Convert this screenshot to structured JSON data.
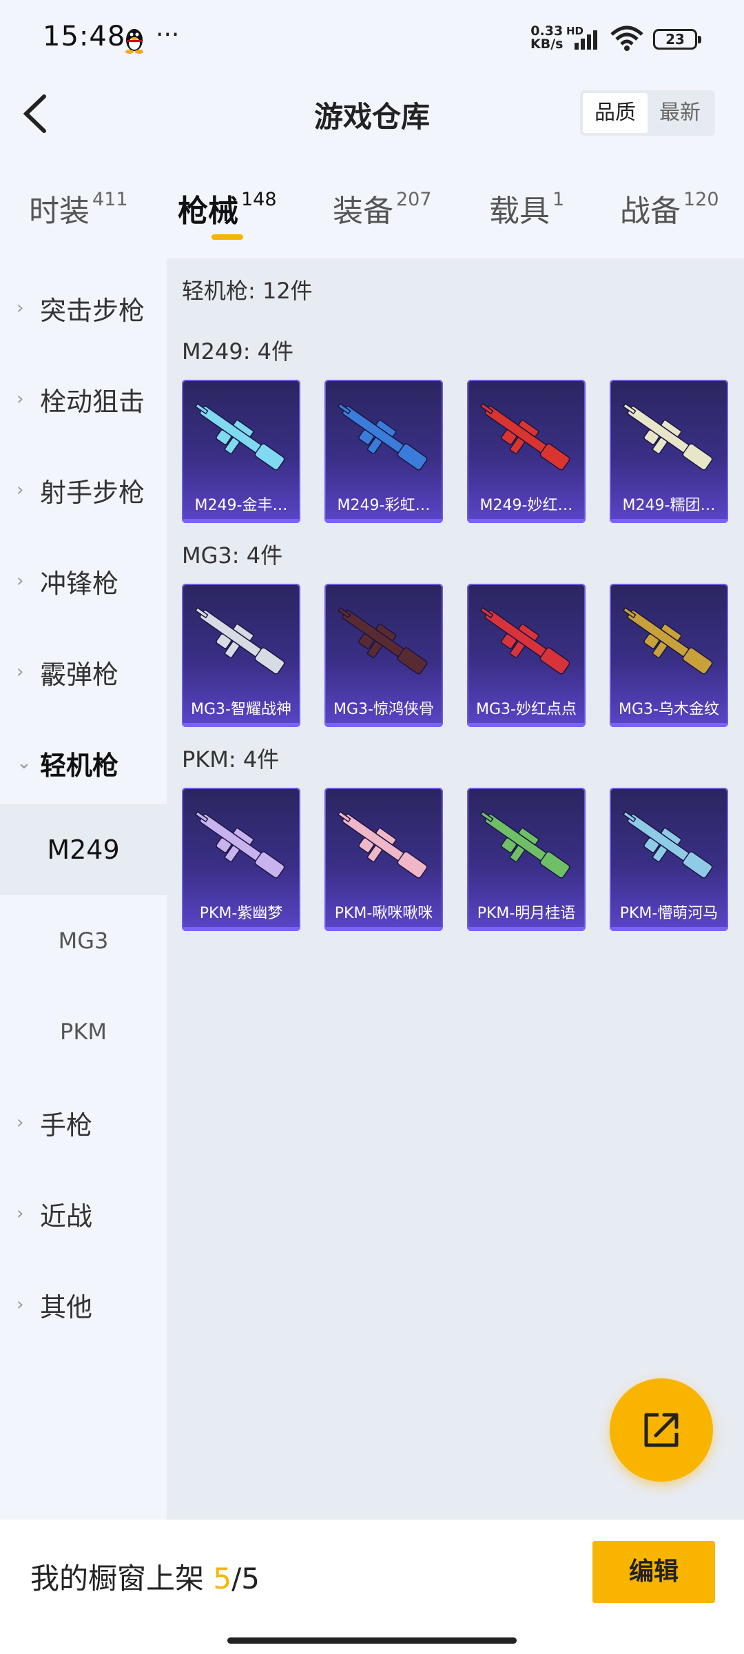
{
  "status": {
    "time": "15:48",
    "dots": "···",
    "net_speed_value": "0.33",
    "net_speed_unit": "KB/s",
    "hd": "HD",
    "battery": "23"
  },
  "header": {
    "title": "游戏仓库",
    "sort_options": [
      "品质",
      "最新"
    ],
    "sort_active": "品质"
  },
  "tabs": [
    {
      "label": "时装",
      "count": "411"
    },
    {
      "label": "枪械",
      "count": "148"
    },
    {
      "label": "装备",
      "count": "207"
    },
    {
      "label": "载具",
      "count": "1"
    },
    {
      "label": "战备",
      "count": "120"
    }
  ],
  "active_tab": "枪械",
  "sidebar": {
    "categories": [
      "突击步枪",
      "栓动狙击",
      "射手步枪",
      "冲锋枪",
      "霰弹枪",
      "轻机枪"
    ],
    "subitems": [
      "M249",
      "MG3",
      "PKM"
    ],
    "active_subitem": "M249",
    "categories_after": [
      "手枪",
      "近战",
      "其他"
    ]
  },
  "content": {
    "summary": "轻机枪: 12件",
    "sections": [
      {
        "title": "M249: 4件",
        "items": [
          "M249-金丰…",
          "M249-彩虹…",
          "M249-妙红…",
          "M249-糯团…"
        ]
      },
      {
        "title": "MG3: 4件",
        "items": [
          "MG3-智耀战神",
          "MG3-惊鸿侠骨",
          "MG3-妙红点点",
          "MG3-乌木金纹"
        ]
      },
      {
        "title": "PKM: 4件",
        "items": [
          "PKM-紫幽梦",
          "PKM-啾咪啾咪",
          "PKM-明月桂语",
          "PKM-懵萌河马"
        ]
      }
    ],
    "gun_colors": [
      [
        "#7fd9f0",
        "#3a7cd9",
        "#d9342f",
        "#e8e6c8"
      ],
      [
        "#d7dbe4",
        "#5a2a33",
        "#d8323a",
        "#c9a13a"
      ],
      [
        "#c8b3ef",
        "#f0b7c8",
        "#6fbf67",
        "#8fcbe6"
      ]
    ]
  },
  "bottom": {
    "shelf_label": "我的橱窗上架",
    "shelf_current": "5",
    "shelf_total": "/5",
    "edit_label": "编辑"
  }
}
